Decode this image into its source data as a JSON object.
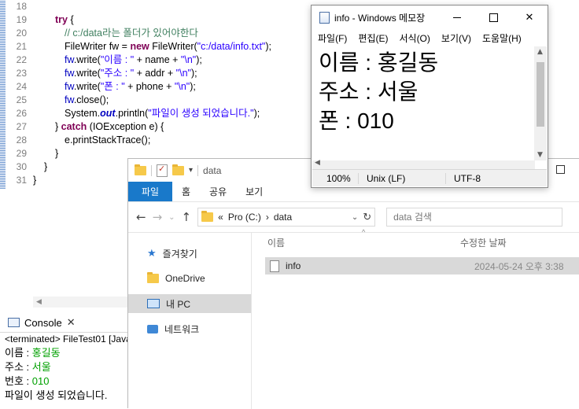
{
  "editor": {
    "line_numbers": [
      "18",
      "19",
      "20",
      "21",
      "22",
      "23",
      "24",
      "25",
      "26",
      "27",
      "28",
      "29",
      "30",
      "31"
    ],
    "lines": [
      {
        "indent": 0,
        "parts": [
          {
            "t": "",
            "c": ""
          }
        ]
      },
      {
        "indent": 2,
        "parts": [
          {
            "t": "try",
            "c": "kw"
          },
          {
            "t": " {",
            "c": ""
          }
        ]
      },
      {
        "indent": 3,
        "parts": [
          {
            "t": "// c:/data라는 폴더가 있어야한다",
            "c": "cm"
          }
        ]
      },
      {
        "indent": 3,
        "parts": [
          {
            "t": "FileWriter fw = ",
            "c": ""
          },
          {
            "t": "new",
            "c": "kw"
          },
          {
            "t": " FileWriter(",
            "c": ""
          },
          {
            "t": "\"c:/data/info.txt\"",
            "c": "str"
          },
          {
            "t": ");",
            "c": ""
          }
        ]
      },
      {
        "indent": 3,
        "parts": [
          {
            "t": "fw",
            "c": "fld"
          },
          {
            "t": ".write(",
            "c": ""
          },
          {
            "t": "\"이름 : \"",
            "c": "str"
          },
          {
            "t": " + name + ",
            "c": ""
          },
          {
            "t": "\"\\n\"",
            "c": "str"
          },
          {
            "t": ");",
            "c": ""
          }
        ]
      },
      {
        "indent": 3,
        "parts": [
          {
            "t": "fw",
            "c": "fld"
          },
          {
            "t": ".write(",
            "c": ""
          },
          {
            "t": "\"주소 : \"",
            "c": "str"
          },
          {
            "t": " + addr + ",
            "c": ""
          },
          {
            "t": "\"\\n\"",
            "c": "str"
          },
          {
            "t": ");",
            "c": ""
          }
        ]
      },
      {
        "indent": 3,
        "parts": [
          {
            "t": "fw",
            "c": "fld"
          },
          {
            "t": ".write(",
            "c": ""
          },
          {
            "t": "\"폰 : \"",
            "c": "str"
          },
          {
            "t": " + phone + ",
            "c": ""
          },
          {
            "t": "\"\\n\"",
            "c": "str"
          },
          {
            "t": ");",
            "c": ""
          }
        ]
      },
      {
        "indent": 3,
        "parts": [
          {
            "t": "fw",
            "c": "fld"
          },
          {
            "t": ".close();",
            "c": ""
          }
        ]
      },
      {
        "indent": 3,
        "parts": [
          {
            "t": "System.",
            "c": ""
          },
          {
            "t": "out",
            "c": "sfld"
          },
          {
            "t": ".println(",
            "c": ""
          },
          {
            "t": "\"파일이 생성 되었습니다.\"",
            "c": "str"
          },
          {
            "t": ");",
            "c": ""
          }
        ]
      },
      {
        "indent": 2,
        "parts": [
          {
            "t": "} ",
            "c": ""
          },
          {
            "t": "catch",
            "c": "kw"
          },
          {
            "t": " (IOException e) {",
            "c": ""
          }
        ]
      },
      {
        "indent": 3,
        "parts": [
          {
            "t": "e.printStackTrace();",
            "c": ""
          }
        ]
      },
      {
        "indent": 2,
        "parts": [
          {
            "t": "}",
            "c": ""
          }
        ]
      },
      {
        "indent": 1,
        "parts": [
          {
            "t": "}",
            "c": ""
          }
        ]
      },
      {
        "indent": 0,
        "parts": [
          {
            "t": "}",
            "c": ""
          }
        ]
      }
    ]
  },
  "console": {
    "tab_label": "Console",
    "terminated": "<terminated> FileTest01 [Java",
    "output": [
      {
        "label": "이름 : ",
        "value": "홍길동"
      },
      {
        "label": "주소 : ",
        "value": "서울"
      },
      {
        "label": "번호 : ",
        "value": "010"
      },
      {
        "label": "파일이 생성 되었습니다.",
        "value": ""
      }
    ]
  },
  "explorer": {
    "title": "data",
    "ribbon_tabs": [
      "파일",
      "홈",
      "공유",
      "보기"
    ],
    "address": {
      "prefix": "«",
      "drive": "Pro (C:)",
      "separator": "›",
      "folder": "data"
    },
    "search_placeholder": "data 검색",
    "nav_items": [
      {
        "label": "즐겨찾기",
        "icon": "star-icon"
      },
      {
        "label": "OneDrive",
        "icon": "folder-icon"
      },
      {
        "label": "내 PC",
        "icon": "pc-icon"
      },
      {
        "label": "네트워크",
        "icon": "network-icon"
      }
    ],
    "columns": {
      "name": "이름",
      "modified": "수정한 날짜"
    },
    "files": [
      {
        "name": "info",
        "modified": "2024-05-24 오후 3:38"
      }
    ]
  },
  "notepad": {
    "title": "info - Windows 메모장",
    "menu": [
      "파일(F)",
      "편집(E)",
      "서식(O)",
      "보기(V)",
      "도움말(H)"
    ],
    "content": [
      "이름 : 홍길동",
      "주소 : 서울",
      "폰 : 010"
    ],
    "status": {
      "zoom": "100%",
      "eol": "Unix (LF)",
      "encoding": "UTF-8"
    }
  }
}
